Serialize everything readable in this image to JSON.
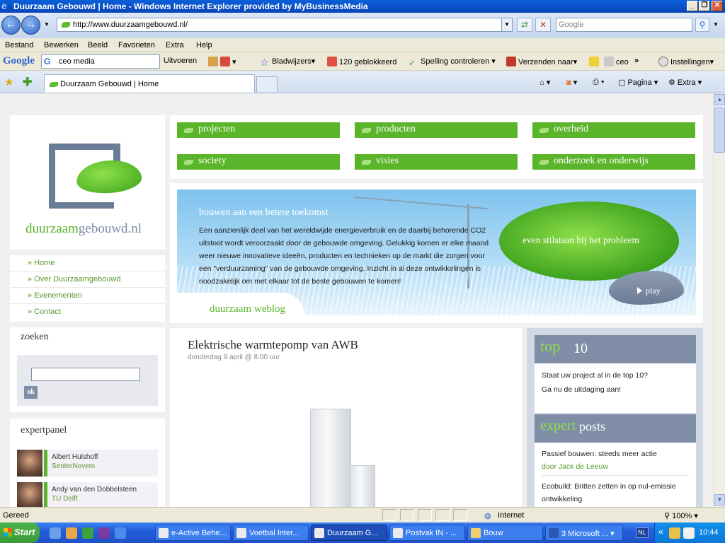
{
  "window": {
    "title": "Duurzaam Gebouwd | Home - Windows Internet Explorer provided by MyBusinessMedia"
  },
  "addressbar": {
    "url": "http://www.duurzaamgebouwd.nl/",
    "search_placeholder": "Google"
  },
  "menu": [
    "Bestand",
    "Bewerken",
    "Beeld",
    "Favorieten",
    "Extra",
    "Help"
  ],
  "google_toolbar": {
    "logo": "Google",
    "search_value": "ceo media",
    "uitvoeren": "Uitvoeren",
    "bladwijzers": "Bladwijzers",
    "geblokkeerd": "120 geblokkeerd",
    "spelling": "Spelling controleren",
    "verzenden": "Verzenden naar",
    "ceo": "ceo",
    "instellingen": "Instellingen"
  },
  "tabs": {
    "active": "Duurzaam Gebouwd | Home",
    "pagina": "Pagina",
    "extra": "Extra"
  },
  "site": {
    "logo_part1": "duurzaam",
    "logo_part2": "gebouwd.nl",
    "nav": [
      "» Home",
      "» Over Duurzaamgebouwd",
      "» Evenementen",
      "» Contact"
    ],
    "search_title": "zoeken",
    "search_button": "ok",
    "expertpanel_title": "expertpanel",
    "experts": [
      {
        "name": "Albert Hulshoff",
        "org": "SenterNovem"
      },
      {
        "name": "Andy van den Dobbelsteen",
        "org": "TU Delft"
      }
    ],
    "tiles": [
      "projecten",
      "producten",
      "overheid",
      "society",
      "visies",
      "onderzoek en onderwijs"
    ],
    "hero": {
      "title": "bouwen aan een betere toekomst",
      "text": "Een aanzienlijk deel van het wereldwijde energieverbruik en de daarbij behorende CO2 uitstoot wordt veroorzaakt door de gebouwde omgeving. Gelukkig komen er elke maand weer nieuwe innovatieve ideeën, producten en technieken op de markt die zorgen voor een \"verduurzaming\" van de gebouwde omgeving. Inzicht in al deze ontwikkelingen is noodzakelijk om met elkaar tot de beste gebouwen te komen!",
      "leaf_text": "even stilstaan bij het probleem",
      "play": "play"
    },
    "weblog_title": "duurzaam weblog",
    "article": {
      "title": "Elektrische warmtepomp van AWB",
      "date": "donderdag 9 april @ 8:00 uur"
    },
    "top10": {
      "pre": "top",
      "post": "10",
      "line1": "Staat uw project al in de top 10?",
      "line2": "Ga nu de uitdaging aan!"
    },
    "expertposts": {
      "pre": "expert",
      "post": "posts",
      "items": [
        {
          "title": "Passief bouwen: steeds meer actie",
          "author": "door Jack de Leeuw"
        },
        {
          "title": "Ecobuild: Britten zetten in op nul-emissie",
          "title2": "ontwikkeling"
        }
      ]
    }
  },
  "statusbar": {
    "status": "Gereed",
    "zone": "Internet",
    "zoom": "100%"
  },
  "taskbar": {
    "start": "Start",
    "tasks": [
      "e-Active Behe...",
      "Voetbal Inter...",
      "Duurzaam G...",
      "Postvak IN - ...",
      "Bouw",
      "3 Microsoft ..."
    ],
    "lang": "NL",
    "clock": "10:44"
  }
}
